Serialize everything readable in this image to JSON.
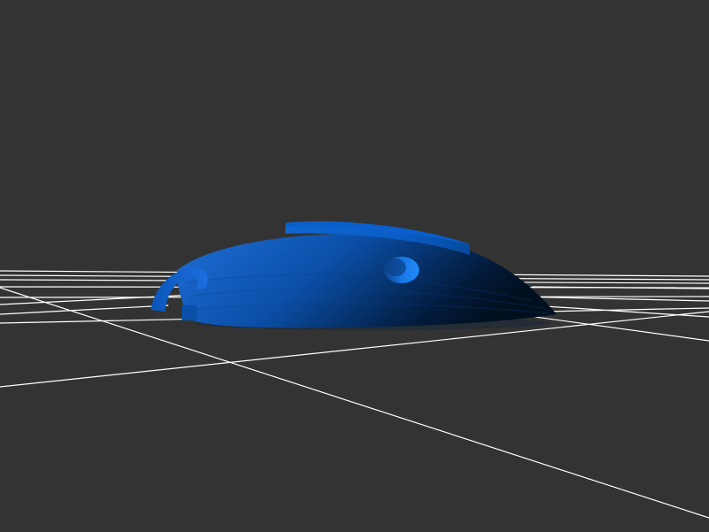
{
  "viewport": {
    "background_color": "#333333"
  },
  "grid": {
    "line_color": "#ffffff",
    "visible": true
  },
  "model": {
    "shape": "dome-cap-with-hook",
    "color_light": "#1f6fd8",
    "color_mid": "#0a56b8",
    "color_dark": "#02142c",
    "hole_color": "#1a7ae6"
  }
}
